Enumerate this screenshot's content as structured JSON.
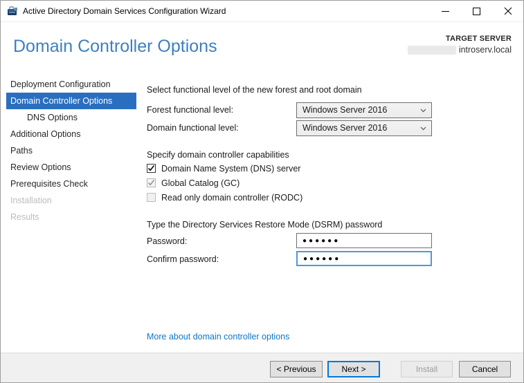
{
  "window": {
    "title": "Active Directory Domain Services Configuration Wizard"
  },
  "header": {
    "title": "Domain Controller Options",
    "target_server_label": "TARGET SERVER",
    "target_server_value": "introserv.local"
  },
  "sidebar": {
    "items": [
      {
        "label": "Deployment Configuration",
        "state": "normal"
      },
      {
        "label": "Domain Controller Options",
        "state": "selected"
      },
      {
        "label": "DNS Options",
        "state": "child"
      },
      {
        "label": "Additional Options",
        "state": "normal"
      },
      {
        "label": "Paths",
        "state": "normal"
      },
      {
        "label": "Review Options",
        "state": "normal"
      },
      {
        "label": "Prerequisites Check",
        "state": "normal"
      },
      {
        "label": "Installation",
        "state": "disabled"
      },
      {
        "label": "Results",
        "state": "disabled"
      }
    ]
  },
  "main": {
    "functional_level": {
      "heading": "Select functional level of the new forest and root domain",
      "forest_label": "Forest functional level:",
      "forest_value": "Windows Server 2016",
      "domain_label": "Domain functional level:",
      "domain_value": "Windows Server 2016"
    },
    "capabilities": {
      "heading": "Specify domain controller capabilities",
      "checkboxes": [
        {
          "label": "Domain Name System (DNS) server",
          "checked": true,
          "enabled": true
        },
        {
          "label": "Global Catalog (GC)",
          "checked": true,
          "enabled": false
        },
        {
          "label": "Read only domain controller (RODC)",
          "checked": false,
          "enabled": false
        }
      ]
    },
    "dsrm": {
      "heading": "Type the Directory Services Restore Mode (DSRM) password",
      "password_label": "Password:",
      "password_value": "●●●●●●",
      "confirm_label": "Confirm password:",
      "confirm_value": "●●●●●●"
    },
    "link": "More about domain controller options"
  },
  "footer": {
    "previous_label": "< Previous",
    "next_label": "Next >",
    "install_label": "Install",
    "cancel_label": "Cancel"
  },
  "colors": {
    "sidebar_selected_blue": "#2a6fbf",
    "heading_blue": "#3e7fc1",
    "link_blue": "#0e76c8",
    "focused_field_border": "#4f96d9",
    "default_button_border": "#0078d7",
    "footer_background": "#f0f0f0"
  }
}
